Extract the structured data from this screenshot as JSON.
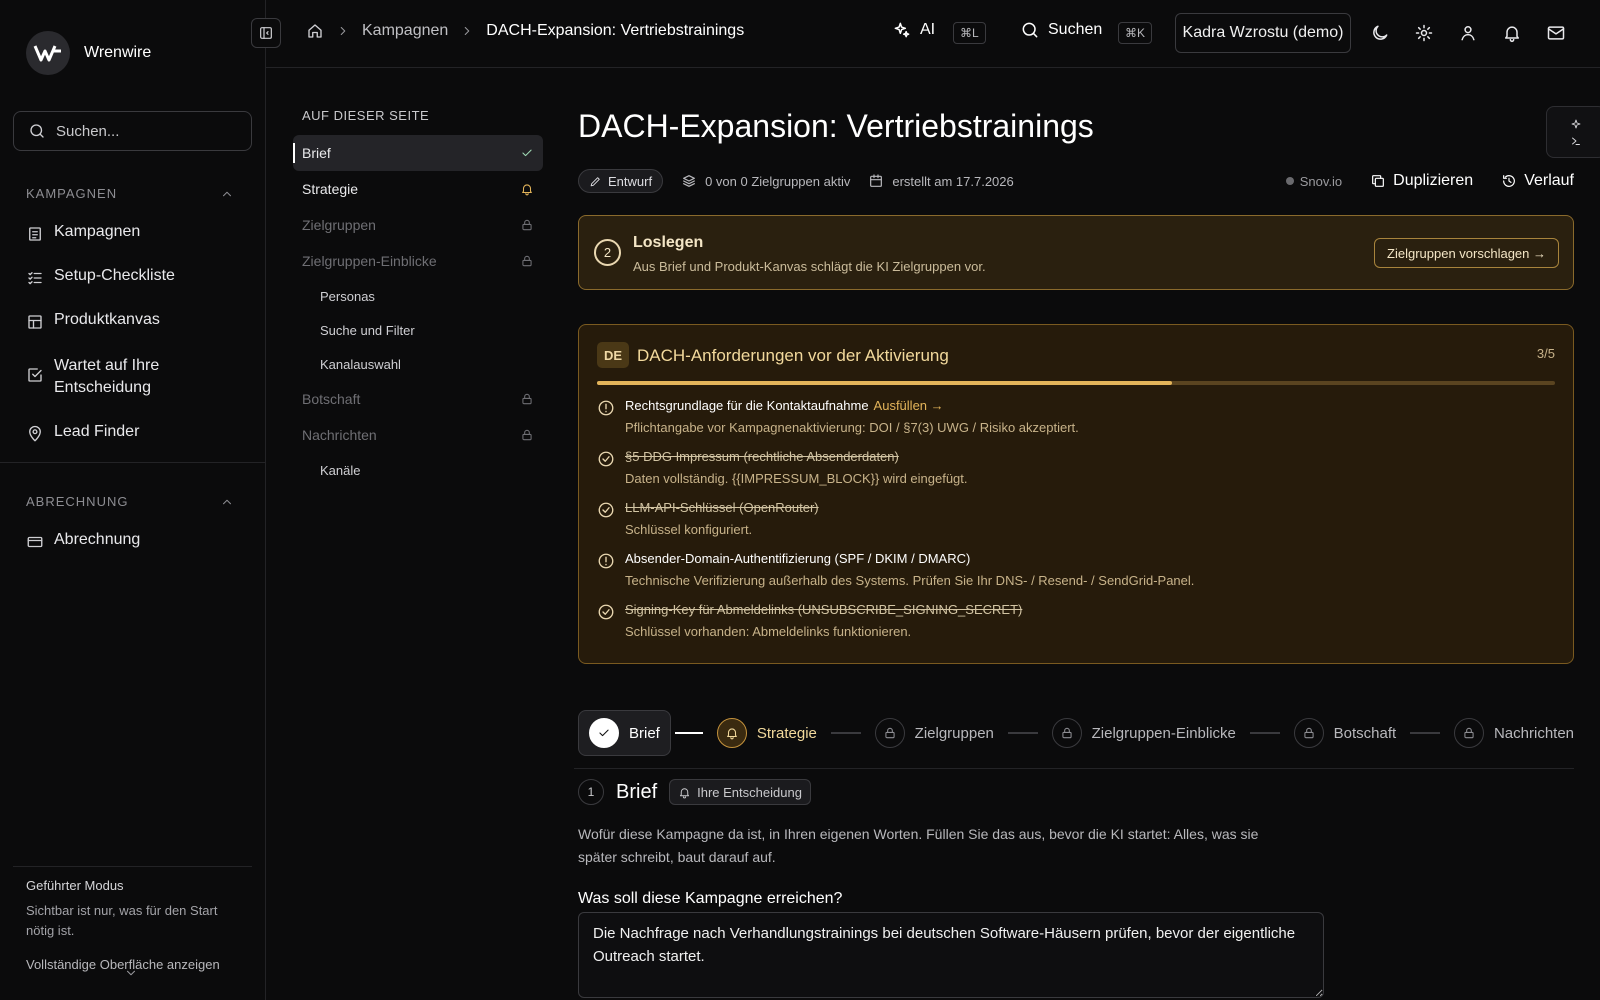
{
  "brand": {
    "name": "Wrenwire"
  },
  "sidebar": {
    "search_placeholder": "Suchen...",
    "section_campaigns": "KAMPAGNEN",
    "items": [
      {
        "label": "Kampagnen",
        "icon": "list-document-icon"
      },
      {
        "label": "Setup-Checkliste",
        "icon": "checklist-icon"
      },
      {
        "label": "Produktkanvas",
        "icon": "layout-icon"
      },
      {
        "label": "Wartet auf Ihre Entscheidung",
        "icon": "check-square-icon"
      },
      {
        "label": "Lead Finder",
        "icon": "map-pin-icon"
      }
    ],
    "section_billing": "ABRECHNUNG",
    "billing_item": {
      "label": "Abrechnung",
      "icon": "credit-card-icon"
    },
    "guided": {
      "title": "Geführter Modus",
      "desc": "Sichtbar ist nur, was für den Start nötig ist.",
      "link": "Vollständige Oberfläche anzeigen"
    }
  },
  "topbar": {
    "breadcrumb": [
      "Kampagnen",
      "DACH-Expansion: Vertriebstrainings"
    ],
    "ai_label": "AI",
    "ai_shortcut": "⌘L",
    "search_label": "Suchen",
    "search_shortcut": "⌘K",
    "workspace": "Kadra Wzrostu (demo)"
  },
  "toc": {
    "title": "AUF DIESER SEITE",
    "items": [
      {
        "label": "Brief",
        "state": "done"
      },
      {
        "label": "Strategie",
        "state": "attention"
      },
      {
        "label": "Zielgruppen",
        "state": "locked"
      },
      {
        "label": "Zielgruppen-Einblicke",
        "state": "locked"
      },
      {
        "label": "Personas",
        "sub": true
      },
      {
        "label": "Suche und Filter",
        "sub": true
      },
      {
        "label": "Kanalauswahl",
        "sub": true
      },
      {
        "label": "Botschaft",
        "state": "locked"
      },
      {
        "label": "Nachrichten",
        "state": "locked"
      },
      {
        "label": "Kanäle",
        "sub": true
      }
    ]
  },
  "page": {
    "title": "DACH-Expansion: Vertriebstrainings",
    "status": "Entwurf",
    "audiences": "0 von 0 Zielgruppen aktiv",
    "created": "erstellt am 17.7.2026",
    "provider": "Snov.io",
    "duplicate": "Duplizieren",
    "history": "Verlauf"
  },
  "start_card": {
    "step": "2",
    "title": "Loslegen",
    "desc": "Aus Brief und Produkt-Kanvas schlägt die KI Zielgruppen vor.",
    "button": "Zielgruppen vorschlagen →"
  },
  "requirements": {
    "badge": "DE",
    "title": "DACH-Anforderungen vor der Aktivierung",
    "count": "3/5",
    "progress": 0.6,
    "items": [
      {
        "title": "Rechtsgrundlage für die Kontaktaufnahme",
        "action": "Ausfüllen →",
        "desc": "Pflichtangabe vor Kampagnenaktivierung: DOI / §7(3) UWG / Risiko akzeptiert.",
        "done": false
      },
      {
        "title": "§5 DDG Impressum (rechtliche Absenderdaten)",
        "action": "",
        "desc": "Daten vollständig. {{IMPRESSUM_BLOCK}} wird eingefügt.",
        "done": true
      },
      {
        "title": "LLM-API-Schlüssel (OpenRouter)",
        "action": "",
        "desc": "Schlüssel konfiguriert.",
        "done": true
      },
      {
        "title": "Absender-Domain-Authentifizierung (SPF / DKIM / DMARC)",
        "action": "",
        "desc": "Technische Verifizierung außerhalb des Systems. Prüfen Sie Ihr DNS- / Resend- / SendGrid-Panel.",
        "done": false
      },
      {
        "title": "Signing-Key für Abmeldelinks (UNSUBSCRIBE_SIGNING_SECRET)",
        "action": "",
        "desc": "Schlüssel vorhanden: Abmeldelinks funktionieren.",
        "done": true
      }
    ]
  },
  "steps": [
    {
      "label": "Brief",
      "state": "done"
    },
    {
      "label": "Strategie",
      "state": "current"
    },
    {
      "label": "Zielgruppen",
      "state": "locked"
    },
    {
      "label": "Zielgruppen-Einblicke",
      "state": "locked"
    },
    {
      "label": "Botschaft",
      "state": "locked"
    },
    {
      "label": "Nachrichten",
      "state": "locked"
    }
  ],
  "brief": {
    "num": "1",
    "title": "Brief",
    "badge": "Ihre Entscheidung",
    "desc": "Wofür diese Kampagne da ist, in Ihren eigenen Worten. Füllen Sie das aus, bevor die KI startet: Alles, was sie später schreibt, baut darauf auf.",
    "goal_label": "Was soll diese Kampagne erreichen?",
    "goal_value": "Die Nachfrage nach Verhandlungstrainings bei deutschen Software-Häusern prüfen, bevor der eigentliche Outreach startet."
  },
  "colors": {
    "accent": "#e3b45a",
    "warning_bg": "#2a200f",
    "background": "#0b0b0c"
  }
}
